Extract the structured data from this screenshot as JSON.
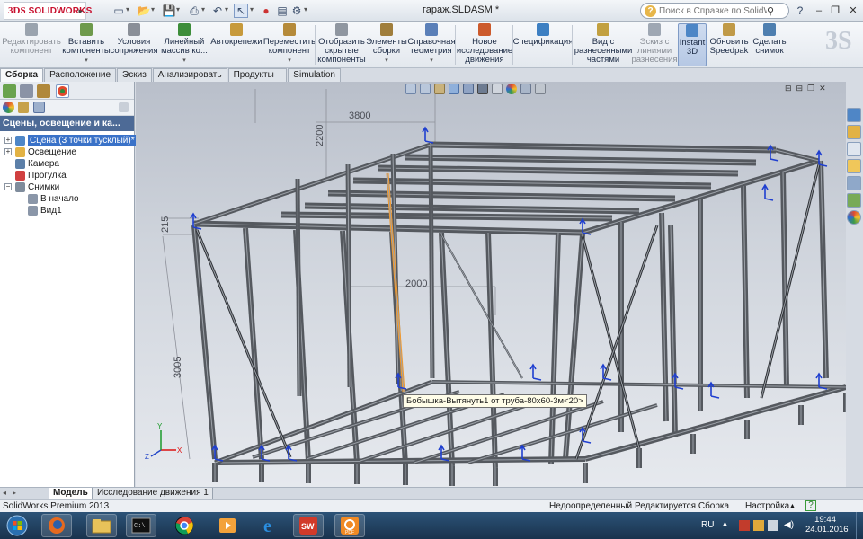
{
  "window": {
    "app_logo": "SOLIDWORKS",
    "doc_title": "гараж.SLDASM *",
    "help_search_placeholder": "Поиск в Справке по SolidWorks",
    "controls": [
      "minimize",
      "restore",
      "close"
    ]
  },
  "ribbon": [
    {
      "label": "Редактировать компонент",
      "icon": "edit-component-icon",
      "disabled": true
    },
    {
      "label": "Вставить компоненты",
      "icon": "insert-components-icon"
    },
    {
      "label": "Условия сопряжения",
      "icon": "mate-icon"
    },
    {
      "label": "Линейный массив ко...",
      "icon": "linear-pattern-icon"
    },
    {
      "label": "Автокрепежи",
      "icon": "smart-fasteners-icon"
    },
    {
      "label": "Переместить компонент",
      "icon": "move-component-icon"
    },
    {
      "label": "Отобразить скрытые компоненты",
      "icon": "show-hidden-icon"
    },
    {
      "label": "Элементы сборки",
      "icon": "assembly-features-icon"
    },
    {
      "label": "Справочная геометрия",
      "icon": "reference-geometry-icon"
    },
    {
      "label": "Новое исследование движения",
      "icon": "motion-study-icon"
    },
    {
      "label": "Спецификация",
      "icon": "bom-icon"
    },
    {
      "label": "Вид с разнесенными частями",
      "icon": "exploded-view-icon"
    },
    {
      "label": "Эскиз с линиями разнесения",
      "icon": "explode-line-sketch-icon",
      "disabled": true
    },
    {
      "label": "Instant 3D",
      "icon": "instant3d-icon",
      "active": true
    },
    {
      "label": "Обновить Speedpak",
      "icon": "speedpak-icon"
    },
    {
      "label": "Сделать снимок",
      "icon": "snapshot-icon"
    }
  ],
  "tabs": [
    "Сборка",
    "Расположение",
    "Эскиз",
    "Анализировать",
    "Продукты Office",
    "Simulation"
  ],
  "active_tab": "Сборка",
  "panel": {
    "header": "Сцены, освещение и ка...",
    "tree": [
      {
        "label": "Сцена (3 точки тусклый)*",
        "selected": true,
        "level": 0,
        "expander": "+",
        "icon": "scene-icon"
      },
      {
        "label": "Освещение",
        "level": 0,
        "expander": "+",
        "icon": "lights-icon"
      },
      {
        "label": "Камера",
        "level": 0,
        "expander": "",
        "icon": "camera-icon"
      },
      {
        "label": "Прогулка",
        "level": 0,
        "expander": "",
        "icon": "walkthrough-icon"
      },
      {
        "label": "Снимки",
        "level": 0,
        "expander": "−",
        "icon": "snapshots-icon"
      },
      {
        "label": "В начало",
        "level": 1,
        "expander": "",
        "icon": "snapshot-item-icon"
      },
      {
        "label": "Вид1",
        "level": 1,
        "expander": "",
        "icon": "snapshot-item-icon"
      }
    ]
  },
  "viewport": {
    "dimensions": [
      "3800",
      "2200",
      "215",
      "2000",
      "3005"
    ],
    "tooltip": "Бобышка-Вытянуть1 от труба-80х60-3м<20>",
    "triad_axes": [
      "X",
      "Y",
      "Z"
    ]
  },
  "bottom_tabs": [
    "Модель",
    "Исследование движения 1"
  ],
  "active_bottom_tab": "Модель",
  "status": {
    "product": "SolidWorks Premium 2013",
    "definition": "Недоопределенный",
    "editing": "Редактируется Сборка",
    "settings": "Настройка",
    "help": "?"
  },
  "taskbar": {
    "apps": [
      "start-orb",
      "firefox-icon",
      "explorer-icon",
      "cmd-icon",
      "chrome-icon",
      "media-player-icon",
      "ie-icon",
      "solidworks-icon",
      "pdf-icon"
    ],
    "lang": "RU",
    "time": "19:44",
    "date": "24.01.2016"
  },
  "colors": {
    "header_blue": "#4d6a96",
    "selection": "#3a72c8",
    "highlight_edge": "#f39a2d",
    "beam": "#5a5d63",
    "accent_red": "#c8102e"
  }
}
